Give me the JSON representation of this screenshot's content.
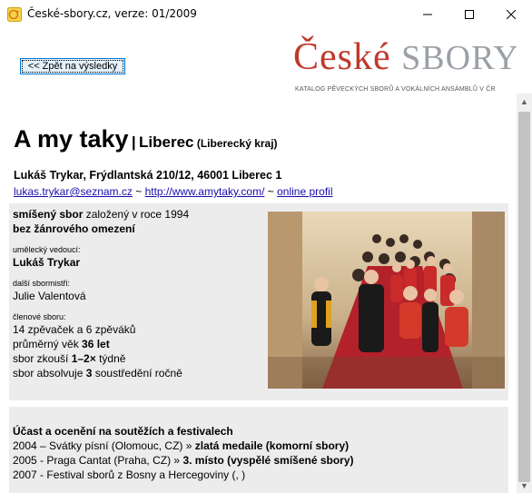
{
  "window": {
    "title": "České-sbory.cz, verze: 01/2009"
  },
  "back_button": "<< Zpět na výsledky",
  "logo": {
    "ceske": "České",
    "sbory": "SBORY",
    "subtitle": "KATALOG PĚVECKÝCH SBORŮ A VOKÁLNÍCH ANSÁMBLŮ V ČR"
  },
  "choir": {
    "name": "A my taky",
    "separator": "|",
    "city": "Liberec",
    "region": "(Liberecký kraj)",
    "address": "Lukáš Trykar, Frýdlantská 210/12, 46001 Liberec 1",
    "email": "lukas.trykar@seznam.cz",
    "tilde": "~",
    "web": "http://www.amytaky.com/",
    "profile": "online profil"
  },
  "info": {
    "type_bold": "smíšený sbor",
    "type_rest": " založený v roce 1994",
    "genre": "bez žánrového omezení",
    "leader_label": "umělecký vedoucí:",
    "leader": "Lukáš Trykar",
    "other_label": "další sbormistři:",
    "other": "Julie Valentová",
    "members_label": "členové sboru:",
    "members": "14 zpěvaček a 6 zpěváků",
    "age_prefix": "průměrný věk ",
    "age_value": "36 let",
    "rehearse_prefix": "sbor zkouší ",
    "rehearse_value": "1–2×",
    "rehearse_suffix": " týdně",
    "retreat_prefix": "sbor absolvuje ",
    "retreat_value": "3",
    "retreat_suffix": " soustředění ročně"
  },
  "awards": {
    "title": "Účast a ocenění na soutěžích a festivalech",
    "items": [
      {
        "text": "2004 – Svátky písní (Olomouc, CZ) » ",
        "bold": "zlatá medaile (komorní sbory)"
      },
      {
        "text": "2005 - Praga Cantat (Praha, CZ) » ",
        "bold": "3. místo (vyspělé smíšené sbory)"
      },
      {
        "text": "2007 - Festival sborů z Bosny a Hercegoviny (, )",
        "bold": ""
      }
    ]
  }
}
